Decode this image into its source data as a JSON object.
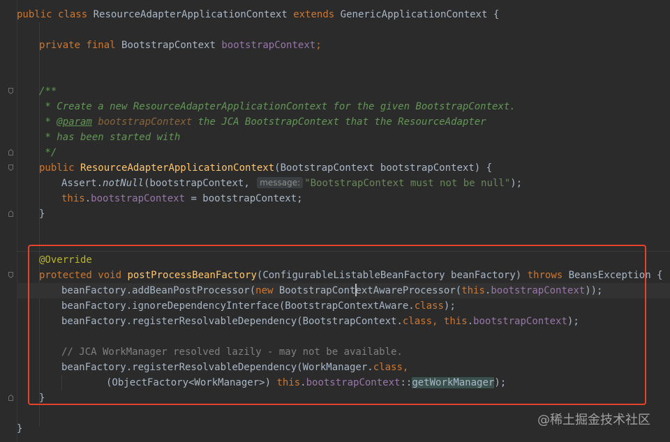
{
  "code": {
    "l0": {
      "kw1": "public",
      "kw2": "class",
      "name": "ResourceAdapterApplicationContext",
      "kw3": "extends",
      "parent": "GenericApplicationContext",
      "brace": "{"
    },
    "l1": {
      "kw1": "private",
      "kw2": "final",
      "type": "BootstrapContext",
      "field": "bootstrapContext",
      "semi": ";"
    },
    "l2": {
      "open": "/**"
    },
    "l3": {
      "text": " * Create a new ResourceAdapterApplicationContext for the given BootstrapContext."
    },
    "l4": {
      "star": " * ",
      "tag": "@param",
      "param": "bootstrapContext",
      "rest": " the JCA BootstrapContext that the ResourceAdapter"
    },
    "l5": {
      "text": " * has been started with"
    },
    "l6": {
      "close": " */"
    },
    "l7": {
      "kw1": "public",
      "name": "ResourceAdapterApplicationContext",
      "args": "(BootstrapContext bootstrapContext) {"
    },
    "l8": {
      "pre": "Assert.",
      "method": "notNull",
      "args": "(bootstrapContext, ",
      "hint": "message:",
      "str": "\"BootstrapContext must not be null\"",
      "end": ");"
    },
    "l9": {
      "kw": "this",
      "dot": ".",
      "field": "bootstrapContext",
      "rest": " = bootstrapContext;"
    },
    "l10": {
      "brace": "}"
    },
    "l11": {
      "ann": "@Override"
    },
    "l12": {
      "kw1": "protected",
      "kw2": "void",
      "name": "postProcessBeanFactory",
      "args": "(ConfigurableListableBeanFactory beanFactory) ",
      "kw3": "throws",
      "rest": " BeansException {"
    },
    "l13": {
      "pre": "beanFactory.addBeanPostProcessor(",
      "kw": "new",
      "cls_a": " BootstrapCont",
      "cls_b": "extAwareProcessor(",
      "kw2": "this",
      "dot": ".",
      "field": "bootstrapContext",
      "end": "));"
    },
    "l14": {
      "pre": "beanFactory.ignoreDependencyInterface(BootstrapContextAware.",
      "kw": "class",
      "end": ");"
    },
    "l15": {
      "pre": "beanFactory.registerResolvableDependency(BootstrapContext.",
      "kw": "class",
      "comma": ", ",
      "kw2": "this",
      "dot": ".",
      "field": "bootstrapContext",
      "end": ");"
    },
    "l16": {
      "text": "// JCA WorkManager resolved lazily - may not be available."
    },
    "l17": {
      "pre": "beanFactory.registerResolvableDependency(WorkManager.",
      "kw": "class",
      "end": ","
    },
    "l18": {
      "pre": "(ObjectFactory<WorkManager>) ",
      "kw": "this",
      "dot": ".",
      "field": "bootstrapContext",
      "sep": "::",
      "method": "getWorkManager",
      "end": ");"
    },
    "l19": {
      "brace": "}"
    },
    "l20": {
      "brace": "}"
    }
  },
  "watermark": "@稀土掘金技术社区",
  "colors": {
    "background": "#2b2b2b",
    "highlight_box": "#e5432a",
    "keyword": "#cc7832",
    "method": "#ffc66d",
    "field": "#9876aa",
    "string": "#6a8759"
  }
}
